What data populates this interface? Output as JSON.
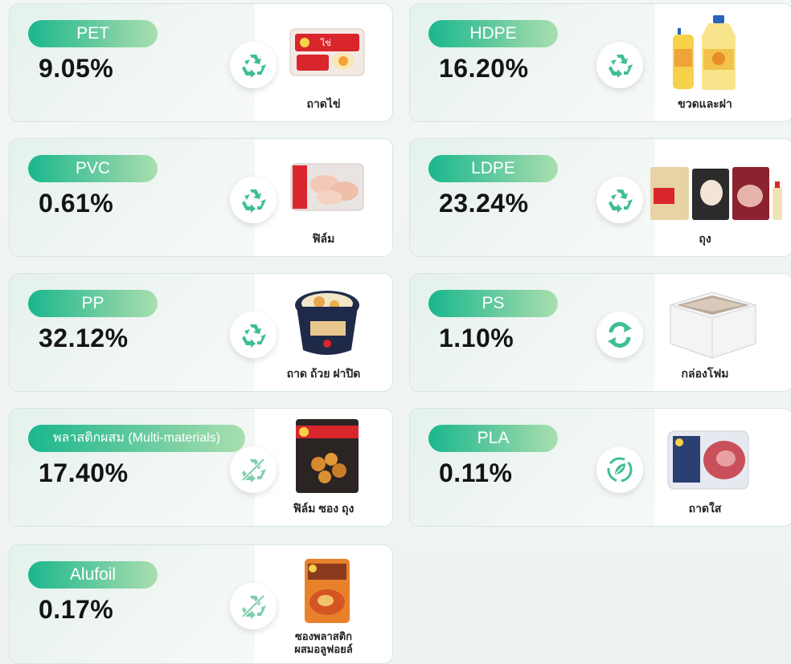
{
  "items": [
    {
      "code": "PET",
      "percent": "9.05%",
      "caption": "ถาดไข่"
    },
    {
      "code": "HDPE",
      "percent": "16.20%",
      "caption": "ขวดและฝา"
    },
    {
      "code": "PVC",
      "percent": "0.61%",
      "caption": "ฟิล์ม"
    },
    {
      "code": "LDPE",
      "percent": "23.24%",
      "caption": "ถุง"
    },
    {
      "code": "PP",
      "percent": "32.12%",
      "caption": "ถาด ถ้วย ฝาปิด"
    },
    {
      "code": "PS",
      "percent": "1.10%",
      "caption": "กล่องโฟม"
    },
    {
      "code": "พลาสติกผสม (Multi-materials)",
      "percent": "17.40%",
      "caption": "ฟิล์ม ซอง ถุง"
    },
    {
      "code": "PLA",
      "percent": "0.11%",
      "caption": "ถาดใส"
    },
    {
      "code": "Alufoil",
      "percent": "0.17%",
      "caption_line1": "ซองพลาสติก",
      "caption_line2": "ผสมอลูฟอยล์"
    }
  ],
  "colors": {
    "accent": "#1ab78d",
    "accent_light": "#a9dfae",
    "icon": "#3fbf8f",
    "text": "#141414"
  }
}
